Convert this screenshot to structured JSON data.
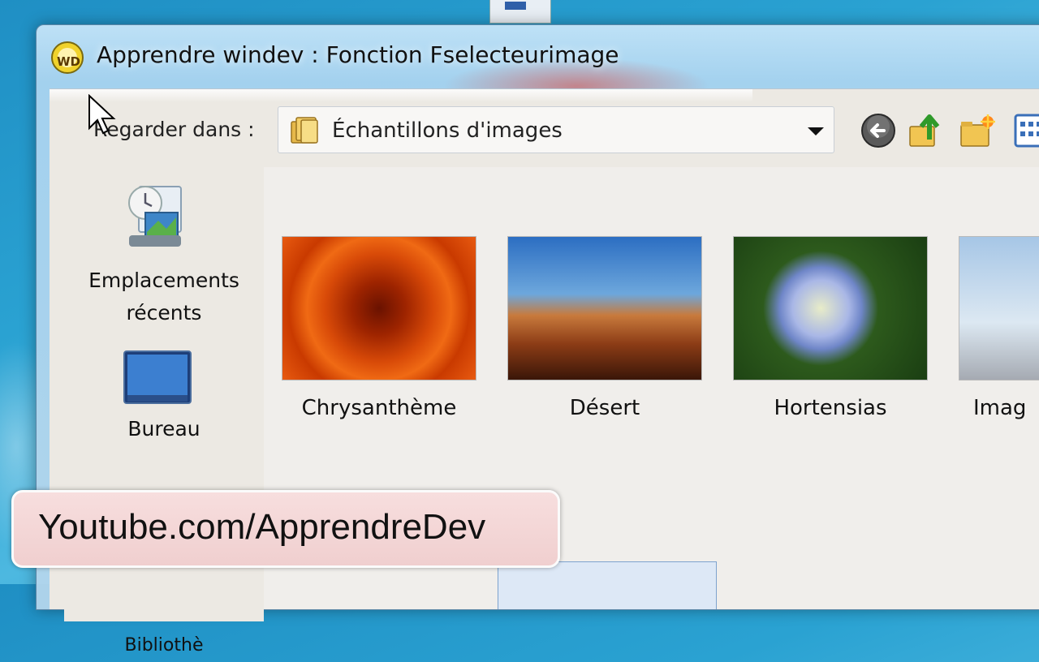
{
  "window": {
    "title": "Apprendre windev : Fonction Fselecteurimage"
  },
  "toolbar": {
    "look_in_label": "Regarder dans :",
    "look_in_value": "Échantillons d'images",
    "buttons": [
      "back-icon",
      "up-folder-icon",
      "new-folder-icon",
      "view-menu-icon"
    ]
  },
  "places": [
    {
      "label": "Emplacements\nrécents",
      "line1": "Emplacements",
      "line2": "récents",
      "icon": "recent-places-icon"
    },
    {
      "label": "Bureau",
      "icon": "desktop-icon"
    },
    {
      "label": "Bibliothè",
      "icon": "library-icon"
    }
  ],
  "files": [
    {
      "name": "Chrysanthème"
    },
    {
      "name": "Désert"
    },
    {
      "name": "Hortensias"
    },
    {
      "name": "Imag"
    }
  ],
  "overlay": {
    "text": "Youtube.com/ApprendreDev"
  }
}
